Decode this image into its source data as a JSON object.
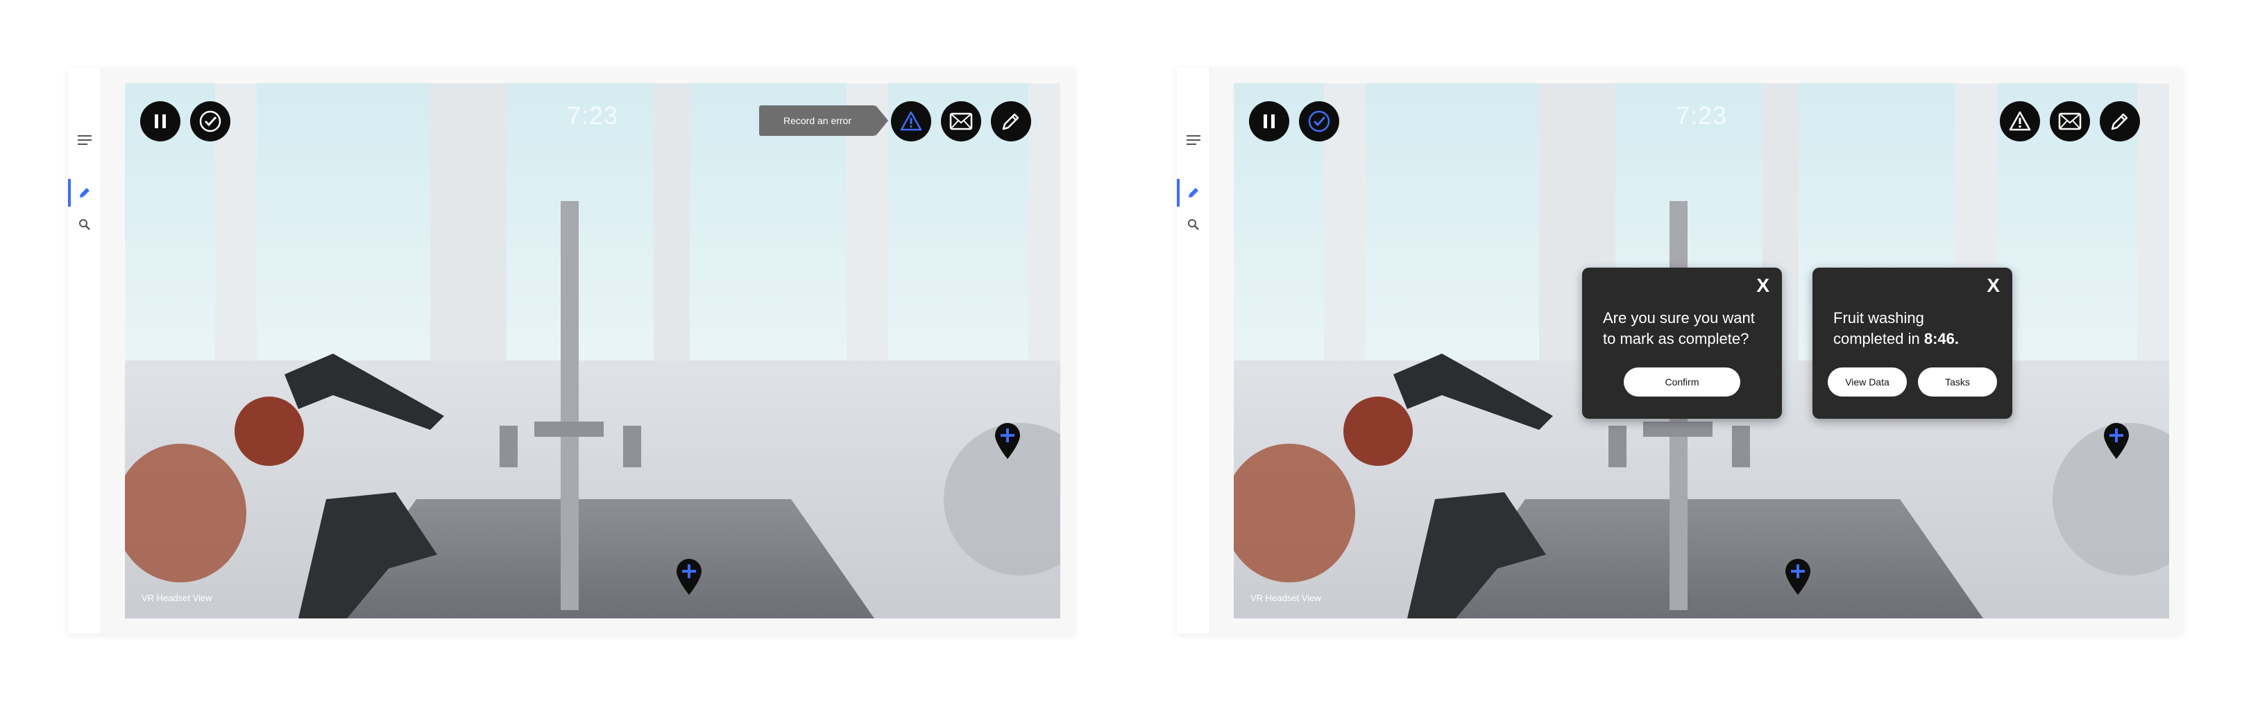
{
  "left_screen": {
    "rail": {
      "menu_icon": "menu-icon",
      "edit_icon": "pencil-icon",
      "search_icon": "search-icon"
    },
    "clock": "7:23",
    "controls": {
      "pause_icon": "pause-icon",
      "check_icon": "check-circle-icon",
      "error_icon": "warning-icon",
      "mail_icon": "mail-icon",
      "edit_icon": "pencil-icon"
    },
    "tooltip": "Record an error",
    "caption": "VR Headset View"
  },
  "right_screen": {
    "rail": {
      "menu_icon": "menu-icon",
      "edit_icon": "pencil-icon",
      "search_icon": "search-icon"
    },
    "clock": "7:23",
    "controls": {
      "pause_icon": "pause-icon",
      "check_icon": "check-circle-icon",
      "error_icon": "warning-icon",
      "mail_icon": "mail-icon",
      "edit_icon": "pencil-icon"
    },
    "caption": "VR Headset View",
    "confirm_dialog": {
      "close_label": "X",
      "message": "Are you sure you want to mark as complete?",
      "confirm_label": "Confirm"
    },
    "result_dialog": {
      "close_label": "X",
      "message_prefix": "Fruit washing completed in ",
      "time": "8:46.",
      "view_data_label": "View Data",
      "tasks_label": "Tasks"
    }
  },
  "colors": {
    "accent": "#3d6ef5",
    "button_bg": "#0d0d0d",
    "dialog_bg": "#2a2a2a",
    "tooltip_bg": "#6e6e6e"
  }
}
